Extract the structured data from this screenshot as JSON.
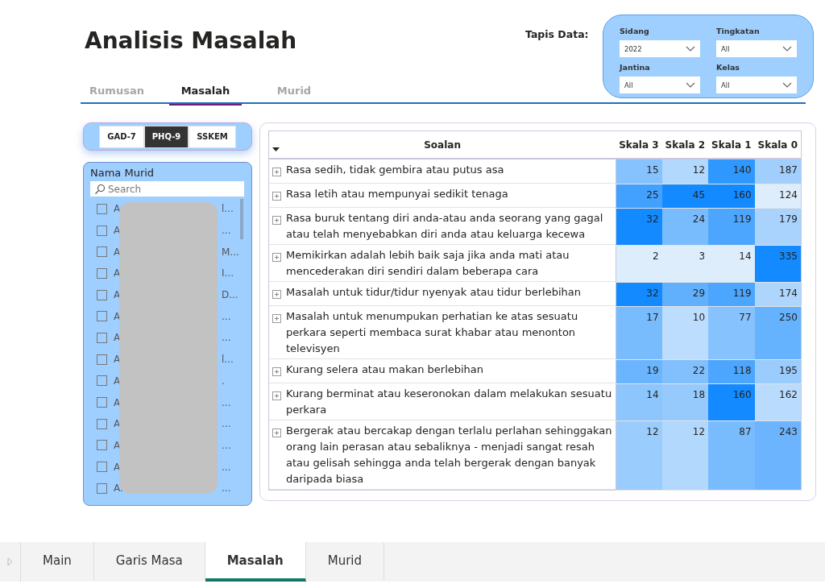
{
  "title": "Analisis Masalah",
  "nav_tabs": [
    {
      "label": "Rumusan",
      "selected": false
    },
    {
      "label": "Masalah",
      "selected": true
    },
    {
      "label": "Murid",
      "selected": false
    }
  ],
  "filter": {
    "label": "Tapis Data:",
    "fields": [
      {
        "label": "Sidang",
        "value": "2022"
      },
      {
        "label": "Tingkatan",
        "value": "All"
      },
      {
        "label": "Jantina",
        "value": "All"
      },
      {
        "label": "Kelas",
        "value": "All"
      }
    ]
  },
  "instrument_toggle": [
    {
      "label": "GAD-7",
      "selected": false
    },
    {
      "label": "PHQ-9",
      "selected": true
    },
    {
      "label": "SSKEM",
      "selected": false
    }
  ],
  "student_list": {
    "title": "Nama Murid",
    "search": {
      "placeholder": "Search"
    },
    "items": [
      {
        "lead": "A",
        "tail": "l...",
        "checked": false
      },
      {
        "lead": "A",
        "tail": "...",
        "checked": false
      },
      {
        "lead": "A",
        "tail": "M...",
        "checked": false
      },
      {
        "lead": "A",
        "tail": "I...",
        "checked": false
      },
      {
        "lead": "A",
        "tail": "D...",
        "checked": false
      },
      {
        "lead": "A",
        "tail": "...",
        "checked": false
      },
      {
        "lead": "A",
        "tail": "...",
        "checked": false
      },
      {
        "lead": "A",
        "tail": "l...",
        "checked": false
      },
      {
        "lead": "A",
        "tail": ".",
        "checked": false
      },
      {
        "lead": "A",
        "tail": "...",
        "checked": false
      },
      {
        "lead": "A",
        "tail": "...",
        "checked": false
      },
      {
        "lead": "A",
        "tail": "...",
        "checked": false
      },
      {
        "lead": "A",
        "tail": "...",
        "checked": false
      },
      {
        "lead": "A.",
        "tail": "...",
        "checked": false
      }
    ]
  },
  "table": {
    "columns": [
      "Soalan",
      "Skala 3",
      "Skala 2",
      "Skala 1",
      "Skala 0"
    ],
    "rows": [
      {
        "question": "Rasa sedih, tidak gembira atau putus asa",
        "values": [
          "15",
          "12",
          "140",
          "187"
        ]
      },
      {
        "question": "Rasa letih atau mempunyai sedikit tenaga",
        "values": [
          "25",
          "45",
          "160",
          "124"
        ]
      },
      {
        "question": "Rasa buruk tentang diri anda-atau anda seorang yang gagal atau telah menyebabkan diri anda atau keluarga kecewa",
        "values": [
          "32",
          "24",
          "119",
          "179"
        ]
      },
      {
        "question": "Memikirkan adalah lebih baik saja jika anda mati atau mencederakan diri sendiri dalam beberapa cara",
        "values": [
          "2",
          "3",
          "14",
          "335"
        ]
      },
      {
        "question": "Masalah untuk tidur/tidur nyenyak atau tidur berlebihan",
        "values": [
          "32",
          "29",
          "119",
          "174"
        ]
      },
      {
        "question": "Masalah untuk menumpukan perhatian ke atas sesuatu perkara seperti membaca surat khabar atau menonton televisyen",
        "values": [
          "17",
          "10",
          "77",
          "250"
        ]
      },
      {
        "question": "Kurang selera atau makan berlebihan",
        "values": [
          "19",
          "22",
          "118",
          "195"
        ]
      },
      {
        "question": "Kurang berminat atau keseronokan dalam melakukan sesuatu perkara",
        "values": [
          "14",
          "18",
          "160",
          "162"
        ]
      },
      {
        "question": "Bergerak atau bercakap dengan terlalu perlahan sehinggakan orang lain perasan atau sebaliknya - menjadi sangat resah atau gelisah sehingga anda telah bergerak dengan banyak daripada biasa",
        "values": [
          "12",
          "12",
          "87",
          "243"
        ]
      }
    ]
  },
  "page_tabs": [
    {
      "label": "Main",
      "selected": false
    },
    {
      "label": "Garis Masa",
      "selected": false
    },
    {
      "label": "Masalah",
      "selected": true
    },
    {
      "label": "Murid",
      "selected": false
    }
  ]
}
